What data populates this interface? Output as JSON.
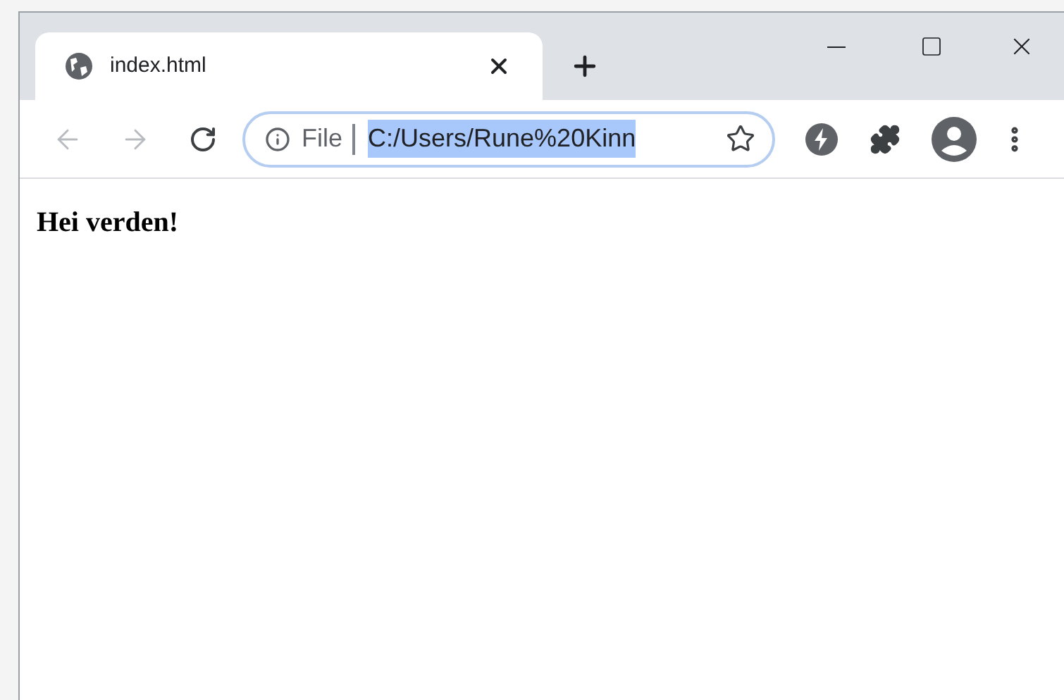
{
  "tabs": [
    {
      "title": "index.html",
      "selected": true
    }
  ],
  "toolbar": {
    "back_disabled": true,
    "forward_disabled": true
  },
  "address_bar": {
    "security_label": "File",
    "url": "C:/Users/Rune%20Kinn",
    "url_selected": true,
    "focused": true
  },
  "page": {
    "heading": "Hei verden!"
  }
}
